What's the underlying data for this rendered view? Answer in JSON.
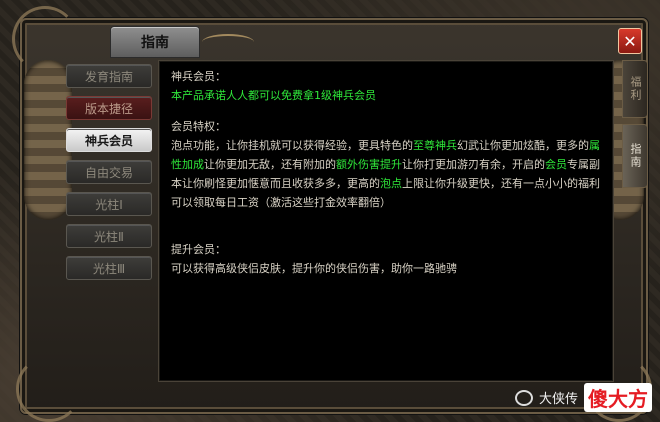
{
  "window": {
    "title": "指南",
    "close_label": "✕"
  },
  "side_tabs": [
    "福利",
    "指南"
  ],
  "nav": {
    "items": [
      {
        "label": "发育指南",
        "state": "normal"
      },
      {
        "label": "版本捷径",
        "state": "red"
      },
      {
        "label": "神兵会员",
        "state": "active"
      },
      {
        "label": "自由交易",
        "state": "normal"
      },
      {
        "label": "光柱Ⅰ",
        "state": "normal"
      },
      {
        "label": "光柱Ⅱ",
        "state": "normal"
      },
      {
        "label": "光柱Ⅲ",
        "state": "normal"
      }
    ]
  },
  "content": {
    "heading1": "神兵会员：",
    "promo": "本产品承诺人人都可以免费拿1级神兵会员",
    "heading2": "会员特权：",
    "para_parts": [
      "泡点功能，让你挂机就可以获得经验，更具特色的",
      "至尊神兵",
      "幻武让你更加炫酷，更多的",
      "属性加成",
      "让你更加无敌，还有附加的",
      "额外伤害提升",
      "让你打更加游刃有余，开启的",
      "会员",
      "专属副本让你刷怪更加惬意而且收获多多，更高的",
      "泡点",
      "上限让你升级更快，还有一点小小的福利可以领取每日工资（激活这些打金效率翻倍）"
    ],
    "heading3": "提升会员：",
    "para3": "可以获得高级侠侣皮肤，提升你的侠侣伤害，助你一路驰骋"
  },
  "watermark": {
    "text": "大侠传",
    "logo": "傻大方"
  },
  "colors": {
    "highlight": "#2fe83a",
    "panel_bg": "#000000",
    "text": "#d9d3c6"
  }
}
